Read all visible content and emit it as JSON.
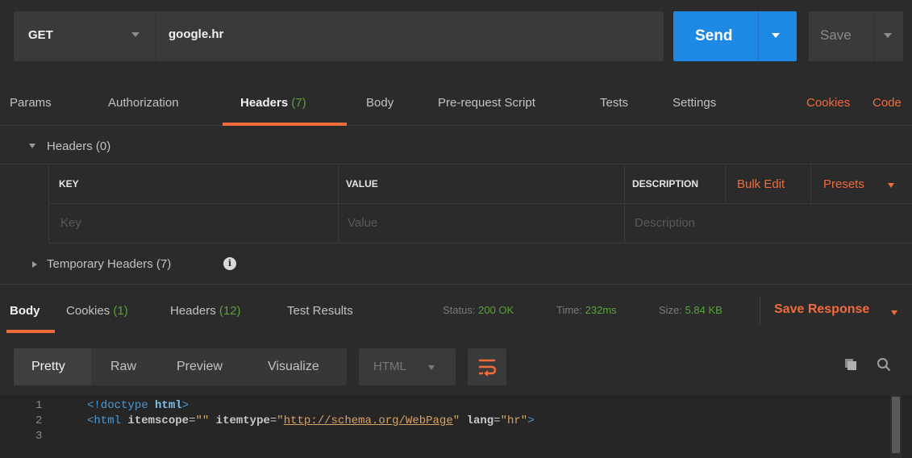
{
  "request": {
    "method": "GET",
    "url": "google.hr",
    "send_label": "Send",
    "save_label": "Save"
  },
  "request_tabs": [
    {
      "label": "Params"
    },
    {
      "label": "Authorization"
    },
    {
      "label": "Headers",
      "count": "(7)"
    },
    {
      "label": "Body"
    },
    {
      "label": "Pre-request Script"
    },
    {
      "label": "Tests"
    },
    {
      "label": "Settings"
    }
  ],
  "request_links": {
    "cookies": "Cookies",
    "code": "Code"
  },
  "headers_section": {
    "title": "Headers (0)",
    "columns": {
      "key": "KEY",
      "value": "VALUE",
      "description": "DESCRIPTION"
    },
    "bulk_edit": "Bulk Edit",
    "presets": "Presets",
    "placeholders": {
      "key": "Key",
      "value": "Value",
      "description": "Description"
    }
  },
  "temporary_headers": {
    "label": "Temporary Headers (7)"
  },
  "response_tabs": [
    {
      "label": "Body"
    },
    {
      "label": "Cookies",
      "count": "(1)"
    },
    {
      "label": "Headers",
      "count": "(12)"
    },
    {
      "label": "Test Results"
    }
  ],
  "response_status": {
    "status_label": "Status:",
    "status_value": "200 OK",
    "time_label": "Time:",
    "time_value": "232ms",
    "size_label": "Size:",
    "size_value": "5.84 KB"
  },
  "save_response": "Save Response",
  "formats": [
    "Pretty",
    "Raw",
    "Preview",
    "Visualize"
  ],
  "language": "HTML",
  "code_lines": [
    {
      "n": "1",
      "text": "<!doctype html>"
    },
    {
      "n": "2",
      "text": "<html itemscope=\"\" itemtype=\"http://schema.org/WebPage\" lang=\"hr\">"
    },
    {
      "n": "3",
      "text": ""
    }
  ],
  "icons": {
    "method_dropdown": "chevron-down-icon",
    "info": "info-icon",
    "wrap": "wrap-lines-icon",
    "copy": "copy-icon",
    "search": "search-icon"
  },
  "colors": {
    "accent": "#f26b3a",
    "send": "#1e88e5",
    "success": "#5aa33a",
    "background": "#2b2b2b"
  }
}
